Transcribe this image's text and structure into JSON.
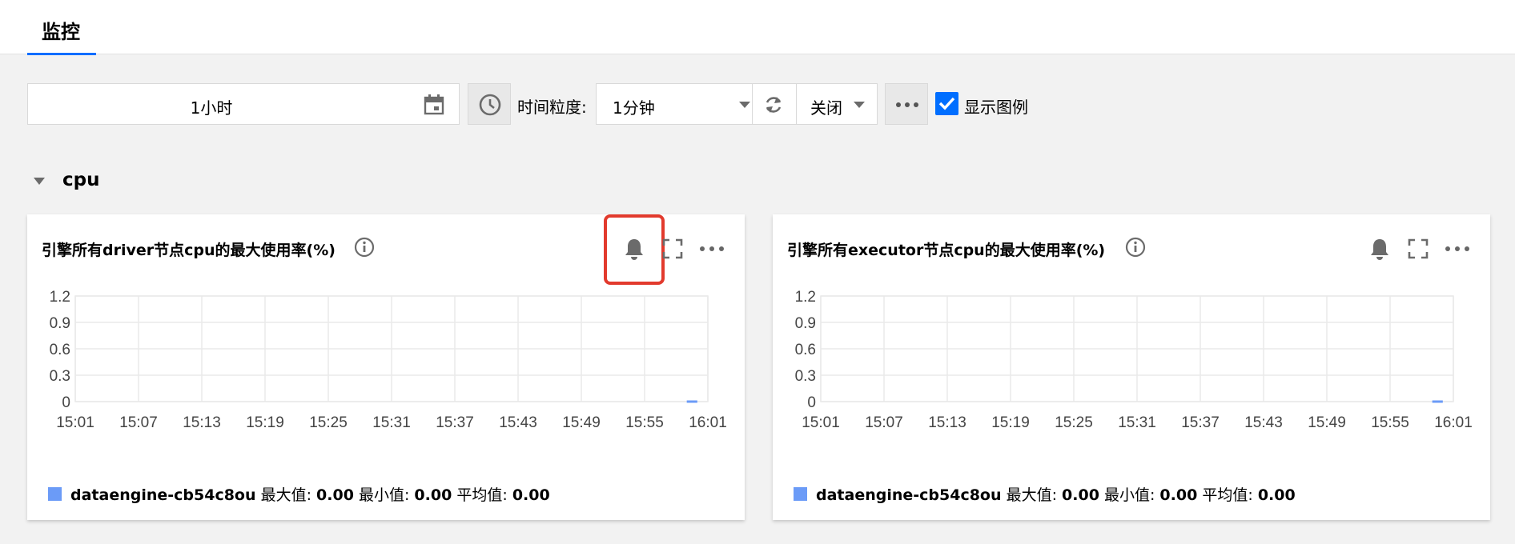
{
  "header": {
    "tab_label": "监控"
  },
  "toolbar": {
    "time_range": "1小时",
    "granularity_label": "时间粒度:",
    "granularity_value": "1分钟",
    "refresh_value": "关闭",
    "show_legend_label": "显示图例",
    "show_legend_checked": true
  },
  "section": {
    "title": "cpu"
  },
  "cards": [
    {
      "title": "引擎所有driver节点cpu的最大使用率(%)",
      "legend": {
        "series": "dataengine-cb54c8ou",
        "max_label": "最大值:",
        "max_value": "0.00",
        "min_label": "最小值:",
        "min_value": "0.00",
        "avg_label": "平均值:",
        "avg_value": "0.00"
      }
    },
    {
      "title": "引擎所有executor节点cpu的最大使用率(%)",
      "legend": {
        "series": "dataengine-cb54c8ou",
        "max_label": "最大值:",
        "max_value": "0.00",
        "min_label": "最小值:",
        "min_value": "0.00",
        "avg_label": "平均值:",
        "avg_value": "0.00"
      }
    }
  ],
  "colors": {
    "accent": "#006eff",
    "series": "#6b9bf7",
    "highlight": "#e23a2d"
  },
  "icons": [
    "calendar-icon",
    "clock-icon",
    "refresh-icon",
    "more-icon",
    "checkbox-icon",
    "info-icon",
    "bell-icon",
    "fullscreen-icon"
  ],
  "chart_data": [
    {
      "type": "line",
      "title": "引擎所有driver节点cpu的最大使用率(%)",
      "x": [
        "15:01",
        "15:07",
        "15:13",
        "15:19",
        "15:25",
        "15:31",
        "15:37",
        "15:43",
        "15:49",
        "15:55",
        "16:01"
      ],
      "yticks": [
        "0",
        "0.3",
        "0.6",
        "0.9",
        "1.2"
      ],
      "ylim": [
        0,
        1.2
      ],
      "grid": true,
      "series": [
        {
          "name": "dataengine-cb54c8ou",
          "points": [
            [
              "15:59",
              0
            ],
            [
              "16:00",
              0
            ]
          ]
        }
      ]
    },
    {
      "type": "line",
      "title": "引擎所有executor节点cpu的最大使用率(%)",
      "x": [
        "15:01",
        "15:07",
        "15:13",
        "15:19",
        "15:25",
        "15:31",
        "15:37",
        "15:43",
        "15:49",
        "15:55",
        "16:01"
      ],
      "yticks": [
        "0",
        "0.3",
        "0.6",
        "0.9",
        "1.2"
      ],
      "ylim": [
        0,
        1.2
      ],
      "grid": true,
      "series": [
        {
          "name": "dataengine-cb54c8ou",
          "points": [
            [
              "15:59",
              0
            ],
            [
              "16:00",
              0
            ]
          ]
        }
      ]
    }
  ]
}
